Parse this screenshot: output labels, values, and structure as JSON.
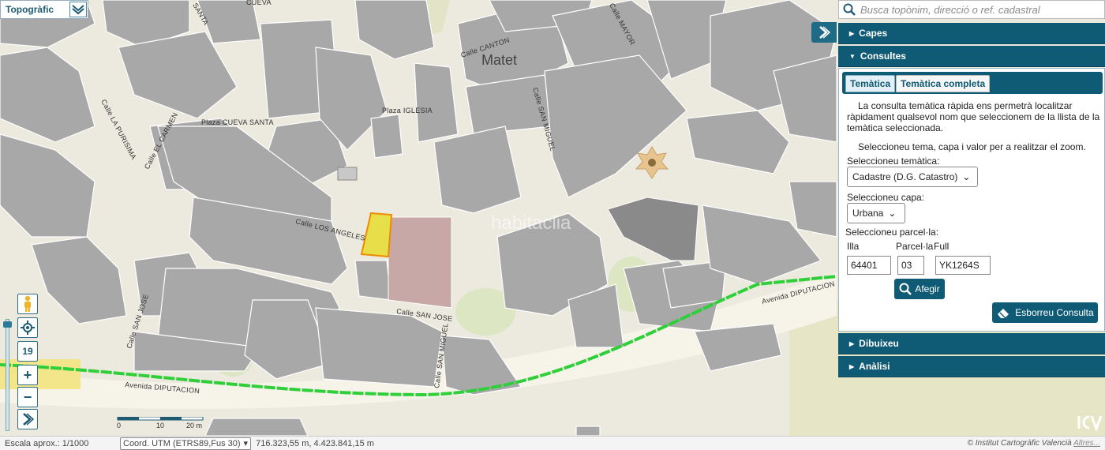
{
  "map": {
    "town": "Matet",
    "watermark": "habitaclia",
    "streets": {
      "canton": "Calle CANTON",
      "mayor": "Calle MAYOR",
      "cueva": "CUEVA",
      "santa": "SANTA",
      "iglesia": "Plaza IGLESIA",
      "cueva_santa": "Plaza CUEVA SANTA",
      "purisima": "Calle LA PURISIMA",
      "carmen": "Calle EL CARMEN",
      "san_miguel_top": "Calle SAN MIGUEL",
      "angeles": "Calle LOS ANGELES",
      "san_jose_h": "Calle SAN JOSE",
      "san_jose_v": "Calle SAN JOSE",
      "san_miguel_bottom": "Calle SAN MIGUEL",
      "diputacion_right": "Avenida DIPUTACION",
      "diputacion_left": "Avenida DIPUTACION"
    },
    "scale": {
      "t0": "0",
      "t1": "10",
      "t2": "20 m"
    }
  },
  "toolbar": {
    "layer": "Topogràfic",
    "zoom_level": "19",
    "zoom_in": "+",
    "zoom_out": "−"
  },
  "status": {
    "scale": "Escala aprox.: 1/1000",
    "coord_system": "Coord. UTM (ETRS89,Fus 30)",
    "coords": "716.323,55 m, 4.423.841,15 m",
    "credit": "© Institut Cartogràfic Valencià",
    "credit_link": "Altres..."
  },
  "search": {
    "placeholder": "Busca topònim, direcció o ref. cadastral"
  },
  "panel": {
    "capes": "Capes",
    "consultes": "Consultes",
    "dibuixeu": "Dibuixeu",
    "analisi": "Anàlisi",
    "tab_active": "Temàtica",
    "tab_inactive": "Temàtica completa",
    "description": "La consulta temàtica ràpida ens permetrà localitzar ràpidament qualsevol nom que seleccionem de la llista de la temàtica seleccionada.",
    "hint": "Seleccioneu tema, capa i valor per a realitzar el zoom.",
    "label_tematica": "Seleccioneu temàtica:",
    "tematica_value": "Cadastre (D.G. Catastro)",
    "label_capa": "Seleccioneu capa:",
    "capa_value": "Urbana",
    "label_parcela": "Seleccioneu parcel·la:",
    "label_illa": "Illa",
    "label_parcela_col": "Parcel·la",
    "label_full": "Full",
    "illa_value": "64401",
    "parcela_value": "03",
    "full_value": "YK1264S",
    "afegir": "Afegir",
    "esborreu": "Esborreu Consulta"
  },
  "colors": {
    "panel": "#0f5a74",
    "building": "#a9a9a9",
    "route": "#2fcf3a",
    "highlight": "#f2e34a"
  }
}
